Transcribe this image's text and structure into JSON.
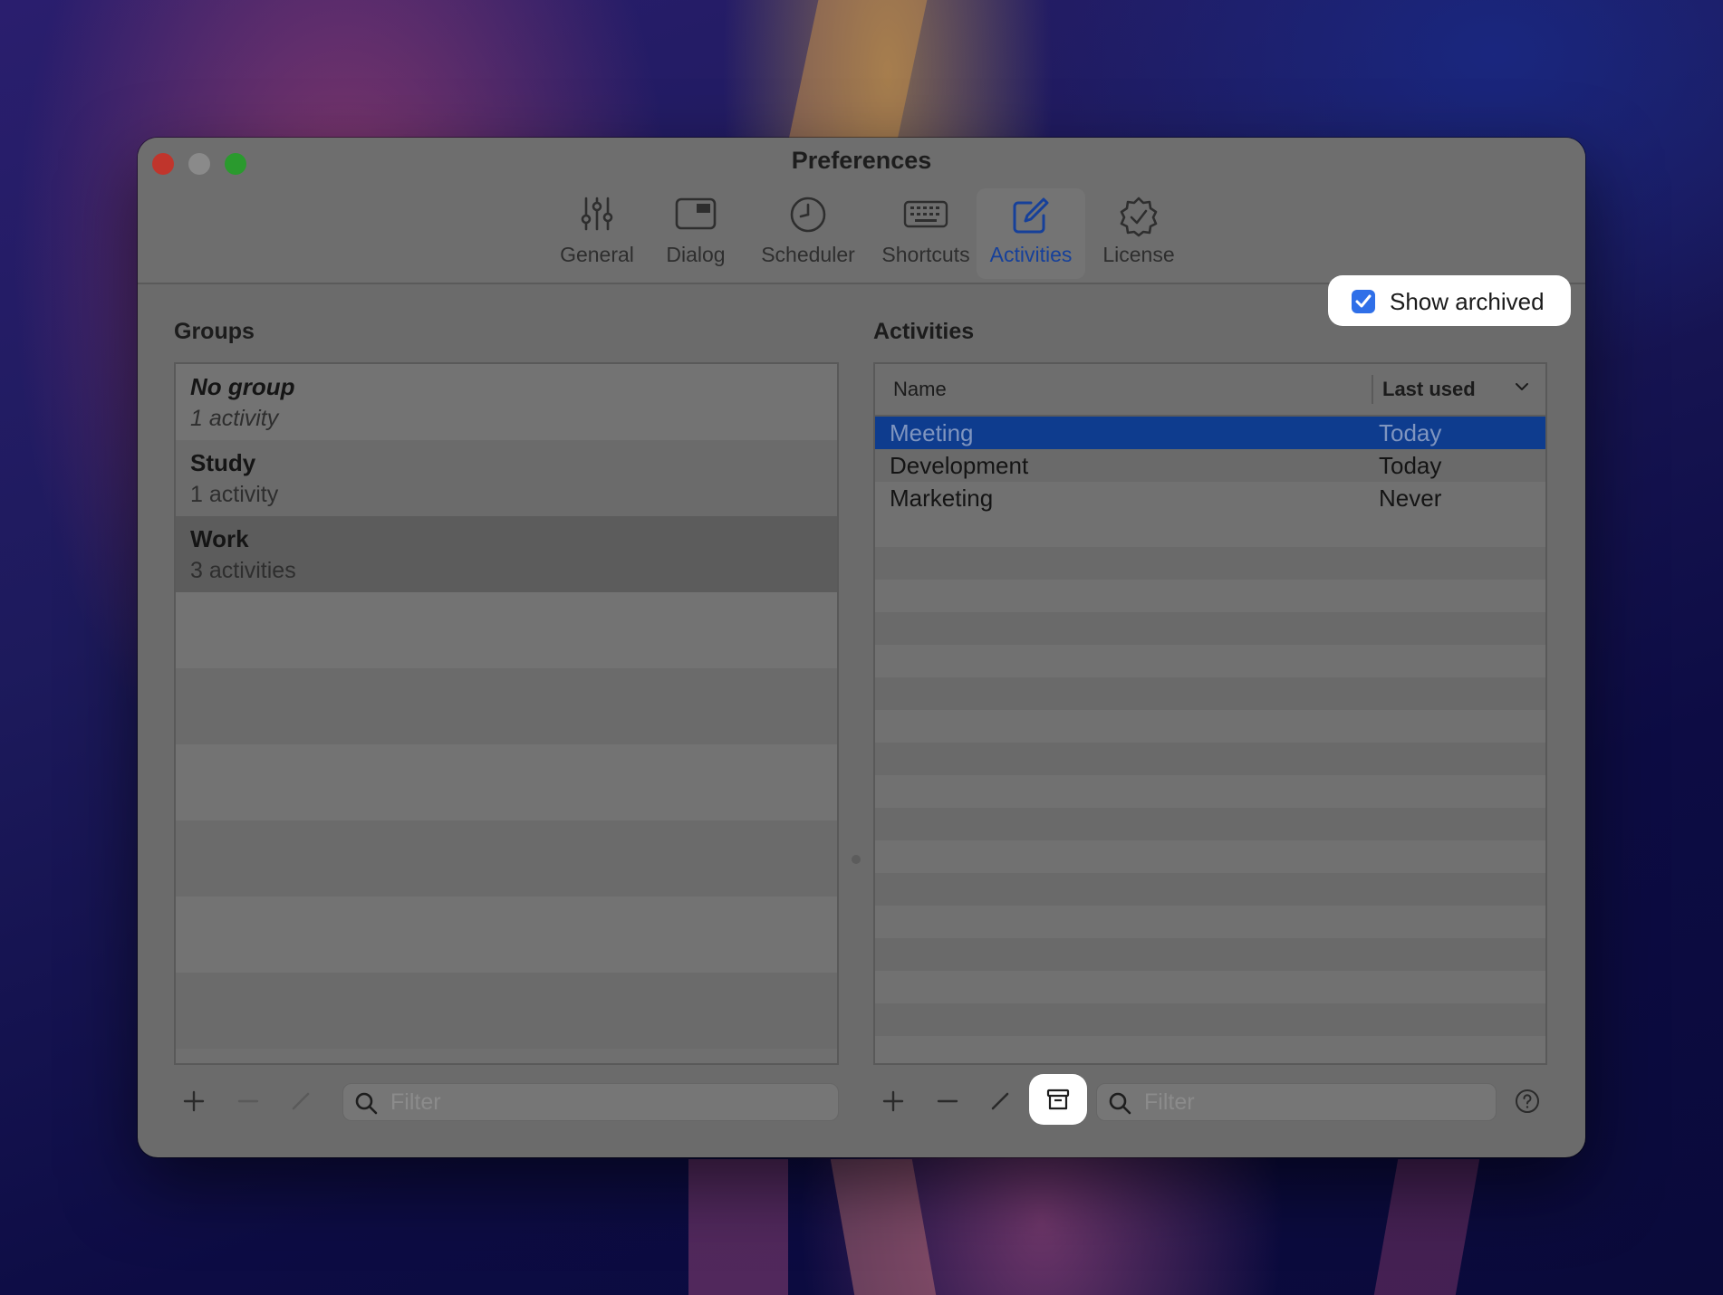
{
  "window": {
    "title": "Preferences"
  },
  "toolbar": {
    "items": [
      {
        "label": "General",
        "icon": "sliders-icon"
      },
      {
        "label": "Dialog",
        "icon": "window-icon"
      },
      {
        "label": "Scheduler",
        "icon": "clock-icon"
      },
      {
        "label": "Shortcuts",
        "icon": "keyboard-icon"
      },
      {
        "label": "Activities",
        "icon": "edit-square-icon",
        "active": true
      },
      {
        "label": "License",
        "icon": "verified-badge-icon"
      }
    ]
  },
  "groups": {
    "title": "Groups",
    "rows": [
      {
        "name": "No group",
        "count": "1 activity"
      },
      {
        "name": "Study",
        "count": "1 activity"
      },
      {
        "name": "Work",
        "count": "3 activities",
        "selected": true
      }
    ],
    "filter_placeholder": "Filter"
  },
  "activities": {
    "title": "Activities",
    "show_archived": {
      "label": "Show archived",
      "checked": true
    },
    "columns": {
      "name": "Name",
      "last_used": "Last used"
    },
    "rows": [
      {
        "name": "Meeting",
        "last_used": "Today",
        "selected": true
      },
      {
        "name": "Development",
        "last_used": "Today"
      },
      {
        "name": "Marketing",
        "last_used": "Never"
      }
    ],
    "filter_placeholder": "Filter"
  },
  "colors": {
    "accent": "#2f6fe8",
    "selection": "#0e3c8e",
    "active_tab_text": "#16409a"
  }
}
